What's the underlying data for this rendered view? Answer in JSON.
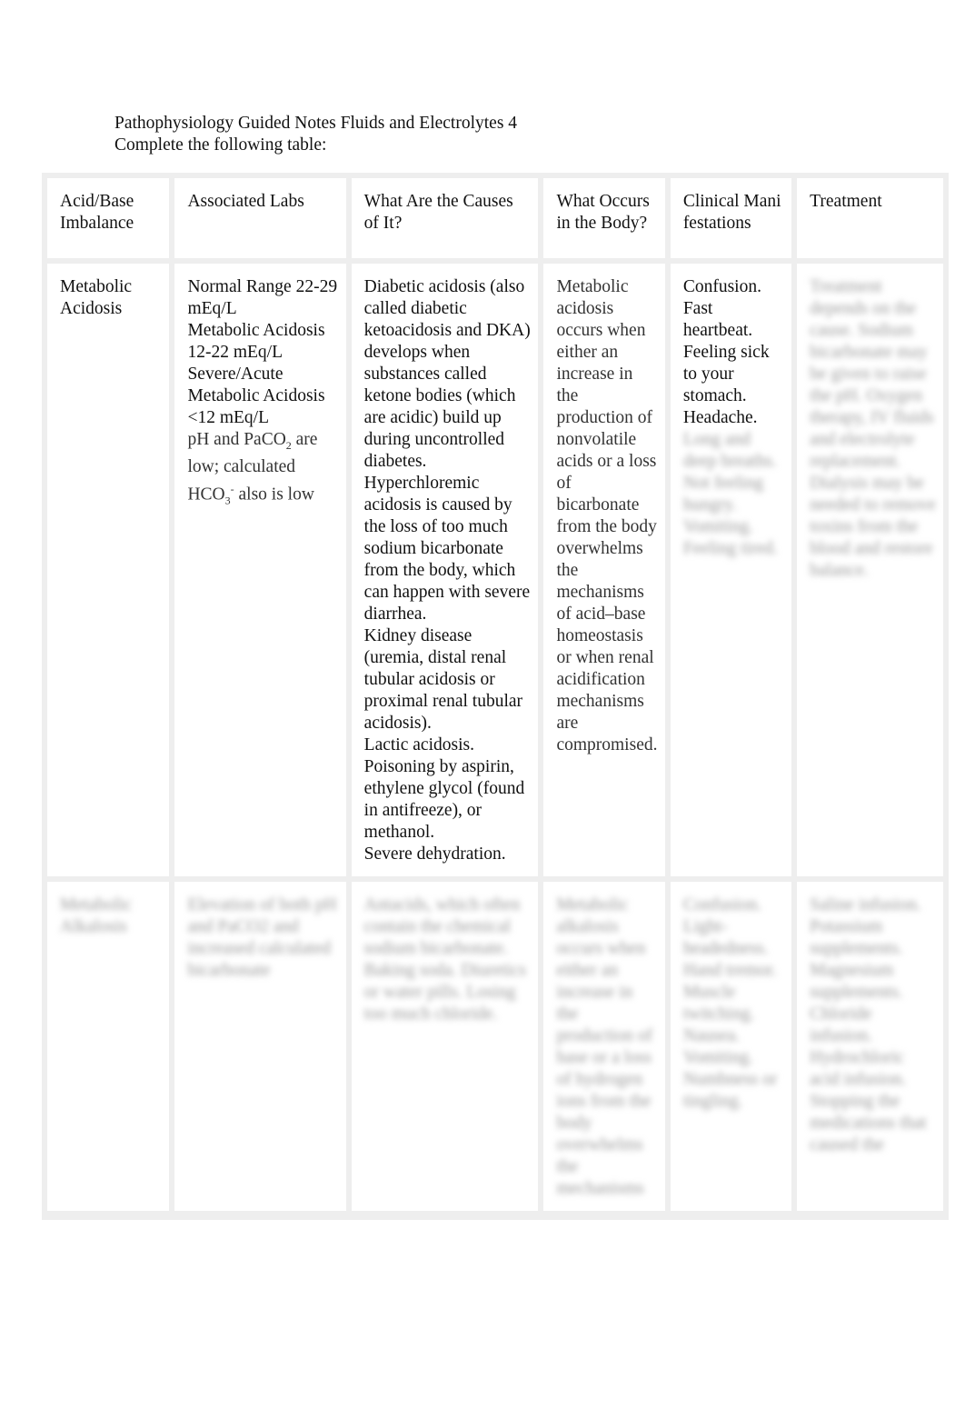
{
  "document": {
    "title": "Pathophysiology Guided Notes Fluids and Electrolytes 4",
    "instruction": "Complete the following table:"
  },
  "table": {
    "headers": [
      "Acid/Base Imbalance",
      "Associated Labs",
      "What Are the Causes of It?",
      "What Occurs in the Body?",
      "Clinical Manifestations",
      "Treatment"
    ],
    "rows": [
      {
        "imbalance": "Metabolic Acidosis",
        "labs": {
          "normal_range": "Normal Range 22-29 mEq/L",
          "metabolic_acidosis": "Metabolic Acidosis 12-22 mEq/L",
          "severe": "Severe/Acute Metabolic Acidosis <12 mEq/L",
          "ph_pre": "pH and PaCO",
          "ph_sub": "2",
          "ph_post": " are low; calculated HCO",
          "hco_sub": "3",
          "hco_sup": "-",
          "hco_post": " also is low"
        },
        "causes": [
          "Diabetic acidosis (also called diabetic ketoacidosis and DKA) develops when substances called ketone bodies (which are acidic) build up during uncontrolled diabetes.",
          "Hyperchloremic acidosis is caused by the loss of too much sodium bicarbonate from the body, which can happen with severe diarrhea.",
          "Kidney disease (uremia, distal renal tubular acidosis or proximal renal tubular acidosis).",
          "Lactic acidosis.",
          "Poisoning by aspirin, ethylene glycol (found in antifreeze), or methanol.",
          "Severe dehydration."
        ],
        "body": "Metabolic acidosis occurs when either an increase in the production of nonvolatile acids  or a loss of bicarbonate from the body overwhelms the mechanisms of acid–base homeostasis or when renal acidification mechanisms are compromised.",
        "manifestations_visible": [
          "Confusion.",
          "Fast heartbeat.",
          "Feeling sick to your stomach.",
          "Headache."
        ],
        "manifestations_blurred": "Long and deep breaths. Not feeling hungry. Vomiting. Feeling tired.",
        "treatment_blurred": "Treatment depends on the cause. Sodium bicarbonate may be given to raise the pH. Oxygen therapy, IV fluids and electrolyte replacement. Dialysis may be needed to remove toxins from the blood and restore balance."
      },
      {
        "imbalance_blurred": "Metabolic Alkalosis",
        "labs_blurred": "Elevation of both pH and PaCO2 and increased calculated bicarbonate",
        "causes_blurred": "Antacids, which often contain the chemical sodium bicarbonate. Baking soda. Diuretics or water pills. Losing too much chloride.",
        "body_blurred": "Metabolic alkalosis occurs when either an increase in the production of base or a loss of hydrogen ions from the body overwhelms the mechanisms",
        "manifestations_blurred": "Confusion. Light-headedness. Hand tremor. Muscle twitching. Nausea. Vomiting. Numbness or tingling.",
        "treatment_blurred": "Saline infusion. Potassium supplements. Magnesium supplements. Chloride infusion. Hydrochloric acid infusion. Stopping the medications that caused the"
      }
    ]
  }
}
